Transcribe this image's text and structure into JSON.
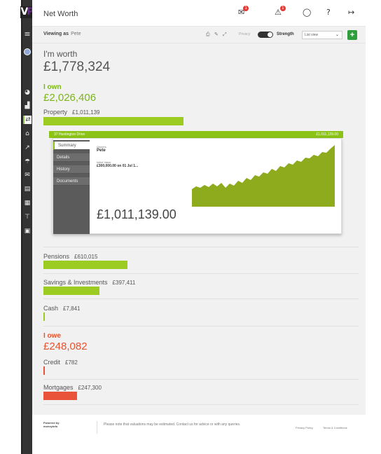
{
  "header": {
    "title": "Net Worth",
    "mail_badge": "1",
    "alert_badge": "1"
  },
  "toolbar": {
    "viewing_label": "Viewing as",
    "viewing_user": "Pete",
    "privacy_label": "Privacy",
    "strength_label": "Strength",
    "view_select": "List view",
    "add_label": "+"
  },
  "summary": {
    "worth_label": "I'm worth",
    "worth_value": "£1,778,324",
    "own_label": "I own",
    "own_value": "£2,026,406",
    "owe_label": "I owe",
    "owe_value": "£248,082"
  },
  "own_categories": [
    {
      "name": "Property",
      "amount": "£1,011,139",
      "fill": 0.5
    },
    {
      "name": "Pensions",
      "amount": "£610,015",
      "fill": 0.3
    },
    {
      "name": "Savings & Investments",
      "amount": "£397,411",
      "fill": 0.2
    },
    {
      "name": "Cash",
      "amount": "£7,841",
      "fill": 0.004
    }
  ],
  "owe_categories": [
    {
      "name": "Credit",
      "amount": "£782",
      "fill": 0.003
    },
    {
      "name": "Mortgages",
      "amount": "£247,300",
      "fill": 0.12
    }
  ],
  "property_card": {
    "header_name": "37 Huntington Drive",
    "header_value": "£1,011,139.00",
    "tabs": [
      "Summary",
      "Details",
      "History",
      "Documents"
    ],
    "active_tab": "Summary",
    "owners_label": "Owners",
    "owners_value": "Pete",
    "initial_label": "Initial Value",
    "initial_value": "£300,000.00 on 01 Jul 1...",
    "big_value": "£1,011,139.00"
  },
  "footer": {
    "powered_line1": "Powered by",
    "powered_line2": "moneyinfo",
    "note": "Please note that valuations may be estimated. Contact us for advice or with any queries.",
    "privacy_link": "Privacy Policy",
    "terms_link": "Terms & Conditions"
  },
  "colors": {
    "own_green": "#7cb518",
    "bar_green": "#9ccc22",
    "owe_red": "#e8532f",
    "add_button": "#2e9e3c"
  },
  "icons": {
    "sidebar": [
      "menu-icon",
      "dashboard-icon",
      "bank-icon",
      "transfer-icon",
      "home-icon",
      "chart-icon",
      "umbrella-icon",
      "mail-icon",
      "document-icon",
      "calendar-icon",
      "signpost-icon",
      "calculator-icon"
    ]
  }
}
